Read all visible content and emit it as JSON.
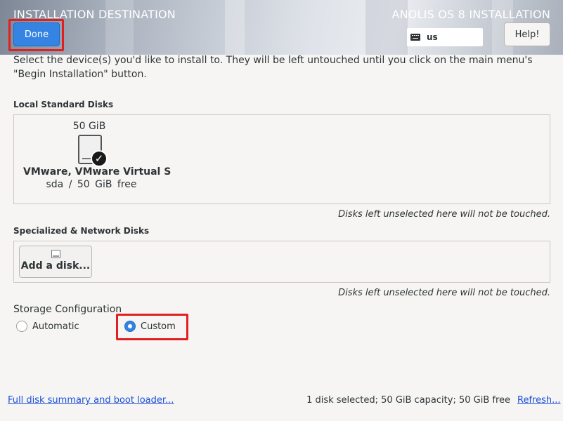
{
  "header": {
    "page_title": "INSTALLATION DESTINATION",
    "product_title": "ANOLIS OS 8 INSTALLATION",
    "done_label": "Done",
    "keyboard_layout": "us",
    "help_label": "Help!"
  },
  "intro_text": "Select the device(s) you'd like to install to.  They will be left untouched until you click on the main menu's \"Begin Installation\" button.",
  "local_disks": {
    "label": "Local Standard Disks",
    "disks": [
      {
        "size": "50 GiB",
        "name": "VMware, VMware Virtual S",
        "device": "sda",
        "separator": "/",
        "free": "50 GiB free",
        "selected": true
      }
    ],
    "note": "Disks left unselected here will not be touched."
  },
  "network_disks": {
    "label": "Specialized & Network Disks",
    "add_label": "Add a disk...",
    "note": "Disks left unselected here will not be touched."
  },
  "storage": {
    "title": "Storage Configuration",
    "options": [
      {
        "label": "Automatic",
        "checked": false
      },
      {
        "label": "Custom",
        "checked": true
      }
    ]
  },
  "footer": {
    "summary_link": "Full disk summary and boot loader...",
    "status": "1 disk selected; 50 GiB capacity; 50 GiB free",
    "refresh_link": "Refresh..."
  },
  "colors": {
    "accent": "#3584e4",
    "highlight": "#e02020",
    "link": "#1b4fd7"
  }
}
